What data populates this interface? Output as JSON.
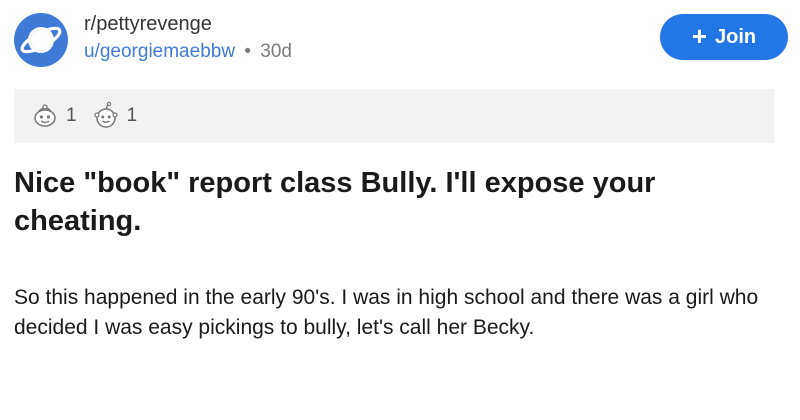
{
  "post": {
    "subreddit": "r/pettyrevenge",
    "username": "u/georgiemaebbw",
    "separator": "•",
    "age": "30d",
    "join_label": "Join",
    "join_icon": "plus-icon",
    "awards": [
      {
        "icon": "wholesome-award-icon",
        "count": "1"
      },
      {
        "icon": "helpful-award-icon",
        "count": "1"
      }
    ],
    "title": "Nice \"book\" report class Bully. I'll expose your cheating.",
    "body": "So this happened in the early 90's. I was in high school and there was a girl who decided I was easy pickings to bully, let's call her Becky."
  },
  "colors": {
    "accent": "#2376e6",
    "username": "#3f7bd6",
    "avatar": "#3f7bd6",
    "awards_bg": "#f2f2f2"
  }
}
